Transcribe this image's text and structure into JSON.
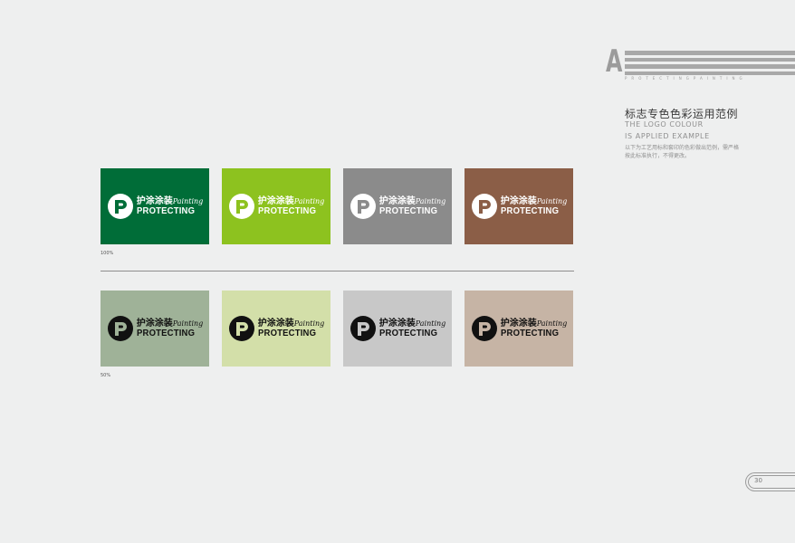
{
  "header": {
    "letter": "A",
    "code": "PROTECTINGPAINTING",
    "title_cn": "标志专色色彩运用范例",
    "title_en_line1": "THE LOGO COLOUR",
    "title_en_line2": "IS APPLIED EXAMPLE",
    "description": "以下为工艺用标和套印的色彩做出范例，需严格按此标准执行，不得更改。"
  },
  "logo": {
    "cn": "护涂涂装",
    "script": "Painting",
    "en": "PROTECTING"
  },
  "rows": [
    {
      "label": "100%",
      "swatches": [
        {
          "name": "dark-green",
          "bg": "#006d38",
          "fg": "#ffffff"
        },
        {
          "name": "lime-green",
          "bg": "#8dc21f",
          "fg": "#ffffff"
        },
        {
          "name": "grey",
          "bg": "#8b8b8b",
          "fg": "#ffffff"
        },
        {
          "name": "brown",
          "bg": "#8b5e47",
          "fg": "#ffffff"
        }
      ]
    },
    {
      "label": "50%",
      "swatches": [
        {
          "name": "dark-green-tint",
          "bg": "#9fb298",
          "fg": "#111111"
        },
        {
          "name": "lime-green-tint",
          "bg": "#d3dfa9",
          "fg": "#111111"
        },
        {
          "name": "grey-tint",
          "bg": "#c8c8c8",
          "fg": "#111111"
        },
        {
          "name": "brown-tint",
          "bg": "#c6b4a5",
          "fg": "#111111"
        }
      ]
    }
  ],
  "page_number": "30"
}
